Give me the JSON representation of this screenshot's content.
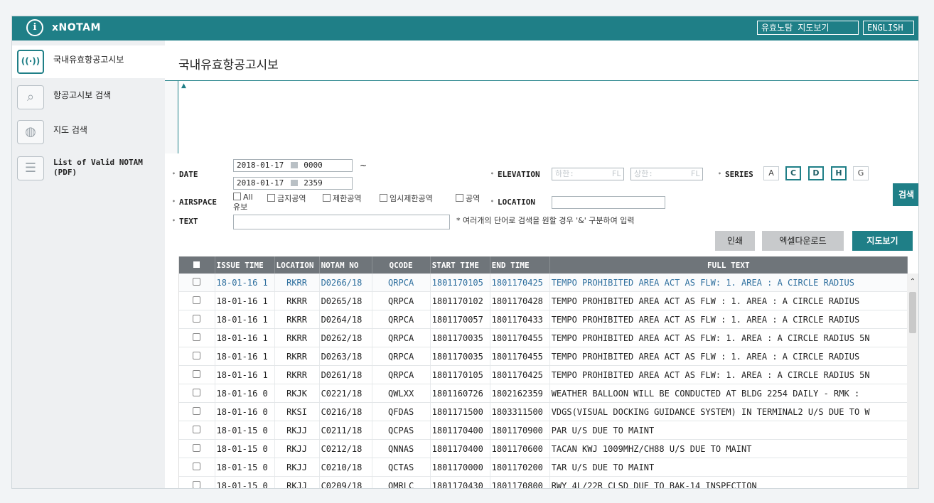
{
  "app": {
    "title": "xNOTAM",
    "logo": "i"
  },
  "header_buttons": {
    "map": "유효노탐 지도보기",
    "english": "ENGLISH"
  },
  "sidebar": {
    "items": [
      {
        "label": "국내유효항공고시보",
        "icon": "radio-broadcast-icon",
        "glyph": "((·))"
      },
      {
        "label": "항공고시보 검색",
        "icon": "search-icon",
        "glyph": "⌕"
      },
      {
        "label": "지도 검색",
        "icon": "globe-icon",
        "glyph": "◍"
      },
      {
        "label": "List of Valid NOTAM (PDF)",
        "icon": "list-icon",
        "glyph": "☰"
      }
    ]
  },
  "page": {
    "title": "국내유효항공고시보"
  },
  "form": {
    "date_label": "DATE",
    "date_from": "2018-01-17",
    "time_from": "0000",
    "tilde": "~",
    "date_to": "2018-01-17",
    "time_to": "2359",
    "elevation_label": "ELEVATION",
    "elev_low_placeholder": "하한:",
    "elev_high_placeholder": "상한:",
    "fl": "FL",
    "series_label": "SERIES",
    "series": [
      {
        "code": "A",
        "selected": false
      },
      {
        "code": "C",
        "selected": true
      },
      {
        "code": "D",
        "selected": true
      },
      {
        "code": "H",
        "selected": true
      },
      {
        "code": "G",
        "selected": false
      }
    ],
    "search_button": "검색",
    "airspace_label": "AIRSPACE",
    "airspace_options": [
      "All",
      "금지공역",
      "제한공역",
      "임시제한공역",
      "공역"
    ],
    "airspace_wrap": "유보",
    "location_label": "LOCATION",
    "location_value": "",
    "text_label": "TEXT",
    "text_value": "",
    "text_note": "* 여러개의 단어로 검색을 원할 경우 '&' 구분하여 입력"
  },
  "actions": {
    "print": "인쇄",
    "excel": "엑셀다운로드",
    "map": "지도보기"
  },
  "table": {
    "headers": [
      "ISSUE TIME",
      "LOCATION",
      "NOTAM NO",
      "QCODE",
      "START TIME",
      "END TIME",
      "FULL TEXT"
    ],
    "rows": [
      [
        "18-01-16 1",
        "RKRR",
        "D0266/18",
        "QRPCA",
        "1801170105",
        "1801170425",
        "TEMPO PROHIBITED AREA ACT AS FLW:   1. AREA : A CIRCLE RADIUS"
      ],
      [
        "18-01-16 1",
        "RKRR",
        "D0265/18",
        "QRPCA",
        "1801170102",
        "1801170428",
        "TEMPO PROHIBITED AREA ACT AS FLW :   1. AREA : A CIRCLE RADIUS"
      ],
      [
        "18-01-16 1",
        "RKRR",
        "D0264/18",
        "QRPCA",
        "1801170057",
        "1801170433",
        "TEMPO PROHIBITED AREA ACT AS FLW :   1. AREA : A CIRCLE RADIUS"
      ],
      [
        "18-01-16 1",
        "RKRR",
        "D0262/18",
        "QRPCA",
        "1801170035",
        "1801170455",
        "TEMPO PROHIBITED AREA ACT AS FLW: 1. AREA : A CIRCLE RADIUS 5N"
      ],
      [
        "18-01-16 1",
        "RKRR",
        "D0263/18",
        "QRPCA",
        "1801170035",
        "1801170455",
        "TEMPO PROHIBITED AREA ACT AS FLW :   1. AREA : A CIRCLE RADIUS"
      ],
      [
        "18-01-16 1",
        "RKRR",
        "D0261/18",
        "QRPCA",
        "1801170105",
        "1801170425",
        "TEMPO PROHIBITED AREA ACT AS FLW: 1. AREA : A CIRCLE RADIUS 5N"
      ],
      [
        "18-01-16 0",
        "RKJK",
        "C0221/18",
        "QWLXX",
        "1801160726",
        "1802162359",
        "WEATHER BALLOON WILL BE CONDUCTED AT BLDG 2254 DAILY   - RMK :"
      ],
      [
        "18-01-16 0",
        "RKSI",
        "C0216/18",
        "QFDAS",
        "1801171500",
        "1803311500",
        "VDGS(VISUAL DOCKING GUIDANCE SYSTEM) IN TERMINAL2 U/S DUE TO W"
      ],
      [
        "18-01-15 0",
        "RKJJ",
        "C0211/18",
        "QCPAS",
        "1801170400",
        "1801170900",
        "PAR U/S DUE TO MAINT"
      ],
      [
        "18-01-15 0",
        "RKJJ",
        "C0212/18",
        "QNNAS",
        "1801170400",
        "1801170600",
        "TACAN KWJ 1009MHZ/CH88 U/S DUE TO MAINT"
      ],
      [
        "18-01-15 0",
        "RKJJ",
        "C0210/18",
        "QCTAS",
        "1801170000",
        "1801170200",
        "TAR U/S DUE TO MAINT"
      ],
      [
        "18-01-15 0",
        "RKJJ",
        "C0209/18",
        "QMRLC",
        "1801170430",
        "1801170800",
        "RWY 4L/22R CLSD DUE TO BAK-14 INSPECTION"
      ]
    ]
  },
  "colors": {
    "accent": "#1f7f87",
    "header_gray": "#6f757a"
  }
}
